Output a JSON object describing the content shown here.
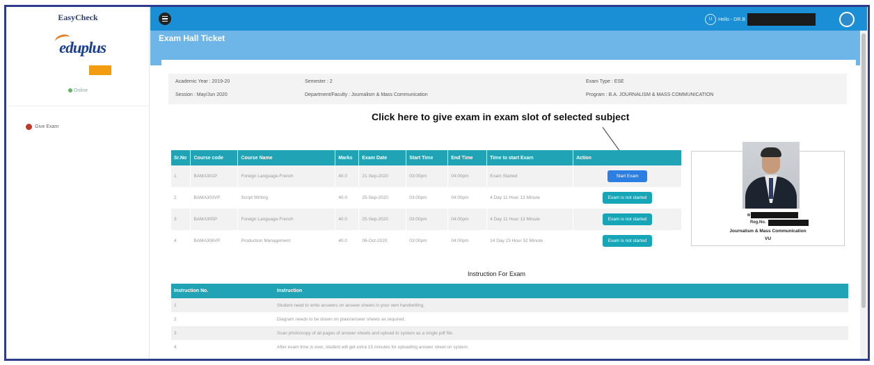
{
  "sidebar": {
    "brand": "EasyCheck",
    "logo_text": "eduplus",
    "online_label": "Online",
    "nav_items": [
      {
        "label": "Give Exam",
        "icon": "exam-icon"
      }
    ]
  },
  "header": {
    "user_initials": "U",
    "user_name": "Hello - DR.B"
  },
  "page": {
    "title": "Exam Hall Ticket"
  },
  "info": {
    "academic_year": "Academic Year : 2019-20",
    "semester": "Semester : 2",
    "exam_type": "Exam Type : ESE",
    "session": "Session : May/Jun 2020",
    "department": "Department/Faculty : Journalism & Mass Communication",
    "program": "Program : B.A. JOURNALISM & MASS COMMUNICATION"
  },
  "callout": "Click here to give exam in exam slot of selected subject",
  "exam_table": {
    "headers": [
      "Sr.No",
      "Course code",
      "Course Name",
      "Marks",
      "Exam Date",
      "Start Time",
      "End Time",
      "Time to start Exam",
      "Action"
    ],
    "rows": [
      {
        "sr": "1",
        "code": "BAMA301P",
        "name": "Foreign Language-French",
        "marks": "40.0",
        "date": "21-Sep-2020",
        "start": "03:00pm",
        "end": "04:00pm",
        "time_left": "Exam Started",
        "action": "Start Exam",
        "action_type": "start"
      },
      {
        "sr": "2",
        "code": "BAMA303VP",
        "name": "Script Writing",
        "marks": "40.0",
        "date": "25-Sep-2020",
        "start": "03:00pm",
        "end": "04:00pm",
        "time_left": "4 Day 11 Hour 13 Minute",
        "action": "Exam is not started",
        "action_type": "not-started"
      },
      {
        "sr": "3",
        "code": "BAMA305P",
        "name": "Foreign Language-French",
        "marks": "40.0",
        "date": "25-Sep-2020",
        "start": "03:00pm",
        "end": "04:00pm",
        "time_left": "4 Day 11 Hour 13 Minute",
        "action": "Exam is not started",
        "action_type": "not-started"
      },
      {
        "sr": "4",
        "code": "BAMA306VP",
        "name": "Production Management",
        "marks": "40.0",
        "date": "06-Oct-2020",
        "start": "03:00pm",
        "end": "04:00pm",
        "time_left": "14 Day 23 Hour 52 Minute",
        "action": "Exam is not started",
        "action_type": "not-started"
      }
    ]
  },
  "profile": {
    "reg_label": "Reg.No.",
    "department": "Journalism & Mass Communication",
    "university": "VU"
  },
  "instructions": {
    "title": "Instruction For Exam",
    "headers": [
      "Instruction No.",
      "Instruction"
    ],
    "rows": [
      {
        "no": "1",
        "text": "Student need to write answers on answer sheets in your own handwriting."
      },
      {
        "no": "2",
        "text": "Diagram needs to be drawn on plain/answer sheets as required."
      },
      {
        "no": "3",
        "text": "Scan photo/copy of all pages of answer sheets and upload to system as a single pdf file."
      },
      {
        "no": "4",
        "text": "After exam time is over, student will get extra 15 minutes for uploading answer sheet on system."
      }
    ]
  },
  "colors": {
    "header": "#1a8fd6",
    "subheader": "#6fb6e8",
    "table_head": "#1fa3b5",
    "start_button": "#2b7fe3",
    "frame": "#2e3a8c"
  }
}
